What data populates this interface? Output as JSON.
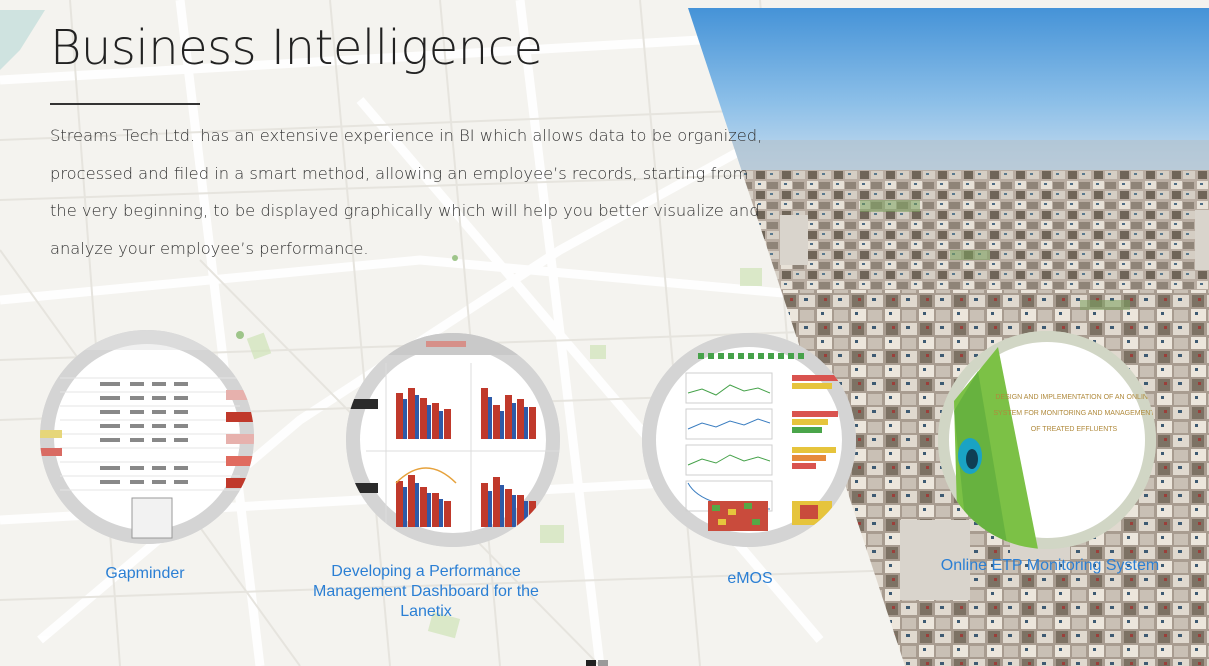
{
  "section": {
    "title": "Business Intelligence",
    "description": "Streams Tech Ltd. has an extensive experience in BI which allows data to be organized, processed and filed in a smart method, allowing an employee’s records, starting from the very beginning, to be displayed graphically which will help you better visualize and analyze your employee’s performance."
  },
  "projects": [
    {
      "label": "Gapminder",
      "thumb_icon": "data-table-thumbnail"
    },
    {
      "label": "Developing a Performance Management Dashboard for the Lanetix",
      "thumb_icon": "bar-chart-dashboard-thumbnail"
    },
    {
      "label": "eMOS",
      "thumb_icon": "monitoring-dashboard-thumbnail"
    },
    {
      "label": "Online ETP Monitoring System",
      "thumb_icon": "slide-title-thumbnail",
      "thumb_text": "DESIGN AND IMPLEMENTATION OF AN ONLINE SYSTEM FOR MONITORING AND MANAGEMENT OF TREATED EFFLUENTS"
    }
  ],
  "colors": {
    "link": "#2b7fd4",
    "title": "#222222",
    "body_text": "#333333",
    "chart_bar": "#c0392b",
    "chart_bar_alt": "#2e5aa8"
  }
}
